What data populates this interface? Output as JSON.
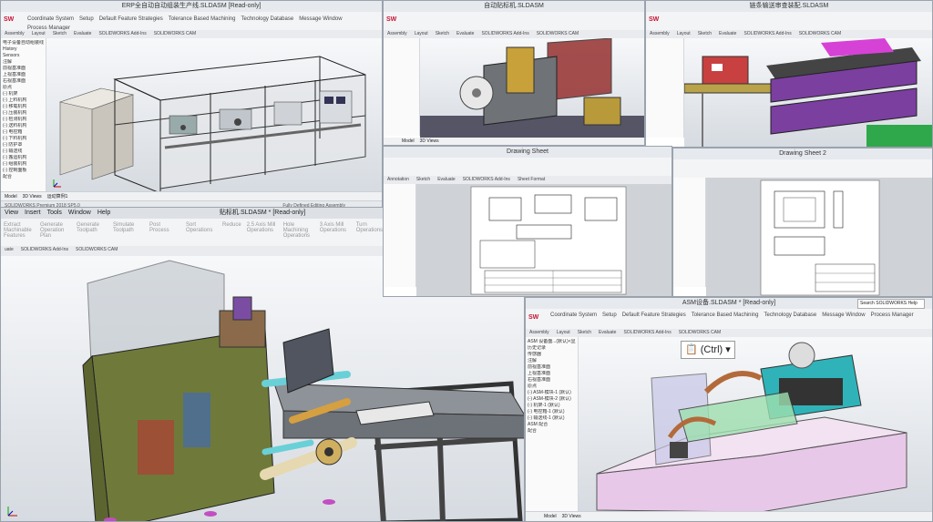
{
  "p1": {
    "title": "ERP全自动自动组装生产线.SLDASM [Read-only]",
    "ribbon": [
      "Coordinate System",
      "Setup",
      "Default Feature Strategies",
      "Tolerance Based Machining",
      "Technology Database",
      "Message Window",
      "Process Manager"
    ],
    "tabs": [
      "Assembly",
      "Layout",
      "Sketch",
      "Evaluate",
      "SOLIDWORKS Add-Ins",
      "SOLIDWORKS CAM"
    ],
    "tree": [
      "电子设备自动组装线",
      "History",
      "Sensors",
      "注解",
      "前视基准面",
      "上视基准面",
      "右视基准面",
      "原点",
      "(-) 机架",
      "(-) 上料机构",
      "(-) 移载机构",
      "(-) 压装机构",
      "(-) 检测机构",
      "(-) 送料机构",
      "(-) 电控箱",
      "(-) 下料机构",
      "(-) 防护罩",
      "(-) 输送线",
      "(-) 搬运机构",
      "(-) 组装机构",
      "(-) 控制面板",
      "配合"
    ],
    "bottom_tabs": [
      "Model",
      "3D Views",
      "运动算例1"
    ],
    "status": "SOLIDWORKS Premium 2018 SP5.0",
    "status_right": "Fully Defined    Editing Assembly"
  },
  "p2": {
    "title": "自动贴标机.SLDASM",
    "tabs": [
      "Assembly",
      "Layout",
      "Sketch",
      "Evaluate",
      "SOLIDWORKS Add-Ins",
      "SOLIDWORKS CAM"
    ],
    "bottom_tabs": [
      "Model",
      "3D Views"
    ]
  },
  "p3": {
    "title": "链条输送审查装配.SLDASM",
    "tabs": [
      "Assembly",
      "Layout",
      "Sketch",
      "Evaluate",
      "SOLIDWORKS Add-Ins",
      "SOLIDWORKS CAM"
    ]
  },
  "p4": {
    "title": "贴标机.SLDASM * [Read-only]",
    "menu": [
      "View",
      "Insert",
      "Tools",
      "Window",
      "Help"
    ],
    "ribbon": [
      "Extract Machinable Features",
      "Generate Operation Plan",
      "Generate Toolpath",
      "Simulate Toolpath",
      "Post Process",
      "Sort Operations",
      "Reduce",
      "2.5 Axis Mill Operations",
      "Hole Machining Operations",
      "3 Axis Mill Operations",
      "Turn Operations",
      "Save Operation Plan",
      "Default Feature Strategies"
    ],
    "tabs": [
      "uate",
      "SOLIDWORKS Add-Ins",
      "SOLIDWORKS CAM"
    ]
  },
  "p5": {
    "title": "Drawing Sheet",
    "tabs": [
      "Annotation",
      "Sketch",
      "Evaluate",
      "SOLIDWORKS Add-Ins",
      "Sheet Format"
    ]
  },
  "p6": {
    "title": "Drawing Sheet 2"
  },
  "p7": {
    "title": "ASM设备.SLDASM * [Read-only]",
    "search_placeholder": "Search SOLIDWORKS Help",
    "ribbon": [
      "Coordinate System",
      "Setup",
      "Default Feature Strategies",
      "Tolerance Based Machining",
      "Technology Database",
      "Message Window",
      "Process Manager"
    ],
    "tabs": [
      "Assembly",
      "Layout",
      "Sketch",
      "Evaluate",
      "SOLIDWORKS Add-Ins",
      "SOLIDWORKS CAM"
    ],
    "tree": [
      "ASM 设备面...(默认)<显示>",
      "历史记录",
      "传感器",
      "注解",
      "前视基准面",
      "上视基准面",
      "右视基准面",
      "原点",
      "(-) ASM-模块-1 (默认)",
      "(-) ASM-模块-2 (默认)",
      "(-) 机架-1 (默认)",
      "(-) 电控箱-1 (默认)",
      "(-) 输送线-1 (默认)",
      "ASM 配合",
      "配合"
    ],
    "paste_label": "(Ctrl)",
    "bottom_tabs": [
      "Model",
      "3D Views"
    ]
  }
}
